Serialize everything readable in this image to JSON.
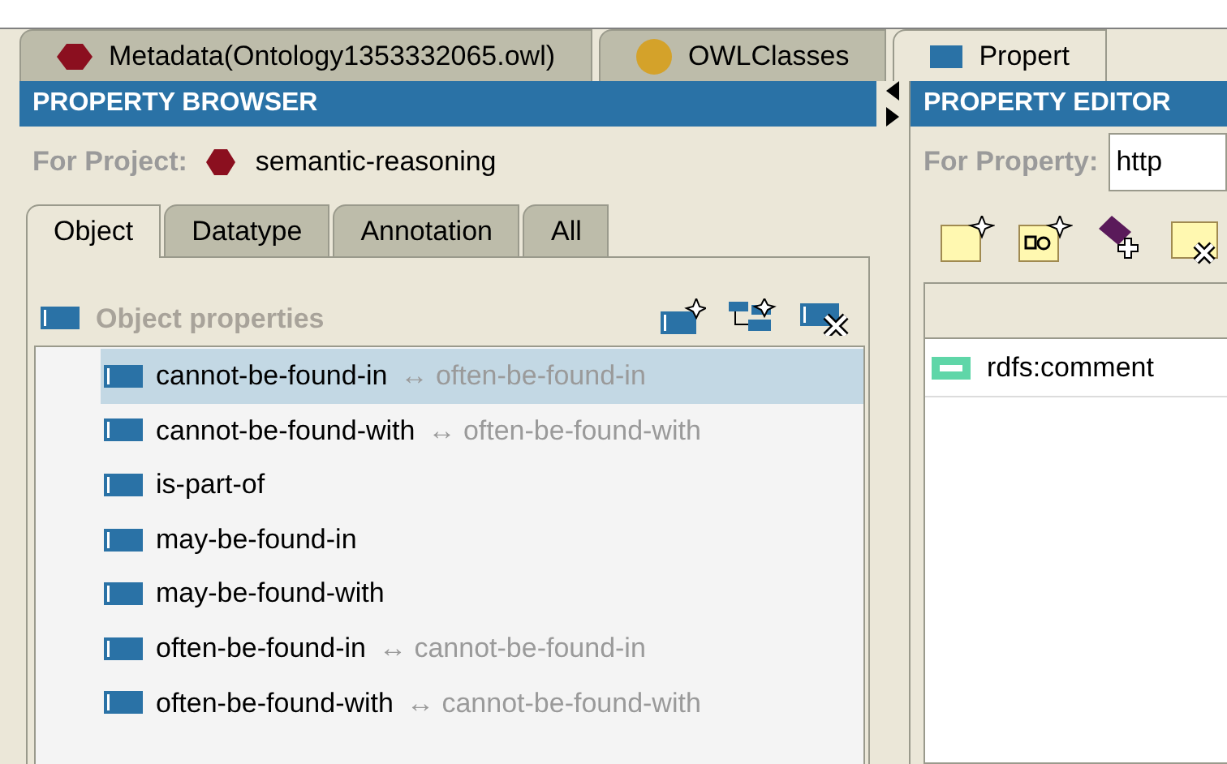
{
  "main_tabs": [
    {
      "label": "Metadata(Ontology1353332065.owl)",
      "kind": "ontology",
      "selected": false
    },
    {
      "label": "OWLClasses",
      "kind": "classes",
      "selected": false
    },
    {
      "label": "Propert",
      "kind": "properties",
      "selected": true
    }
  ],
  "property_browser": {
    "title": "PROPERTY BROWSER",
    "project_label": "For Project:",
    "project_name": "semantic-reasoning",
    "tabs": [
      {
        "label": "Object",
        "selected": true
      },
      {
        "label": "Datatype",
        "selected": false
      },
      {
        "label": "Annotation",
        "selected": false
      },
      {
        "label": "All",
        "selected": false
      }
    ],
    "section_title": "Object properties",
    "properties": [
      {
        "name": "cannot-be-found-in",
        "inverse": "↔ often-be-found-in",
        "selected": true
      },
      {
        "name": "cannot-be-found-with",
        "inverse": "↔ often-be-found-with",
        "selected": false
      },
      {
        "name": "is-part-of",
        "selected": false
      },
      {
        "name": "may-be-found-in",
        "selected": false
      },
      {
        "name": "may-be-found-with",
        "selected": false
      },
      {
        "name": "often-be-found-in",
        "inverse": "↔ cannot-be-found-in",
        "selected": false
      },
      {
        "name": "often-be-found-with",
        "inverse": "↔ cannot-be-found-with",
        "selected": false
      }
    ]
  },
  "property_editor": {
    "title": "PROPERTY EDITOR",
    "property_label": "For Property:",
    "property_value": "http",
    "annotations": [
      {
        "name": "rdfs:comment"
      }
    ]
  }
}
